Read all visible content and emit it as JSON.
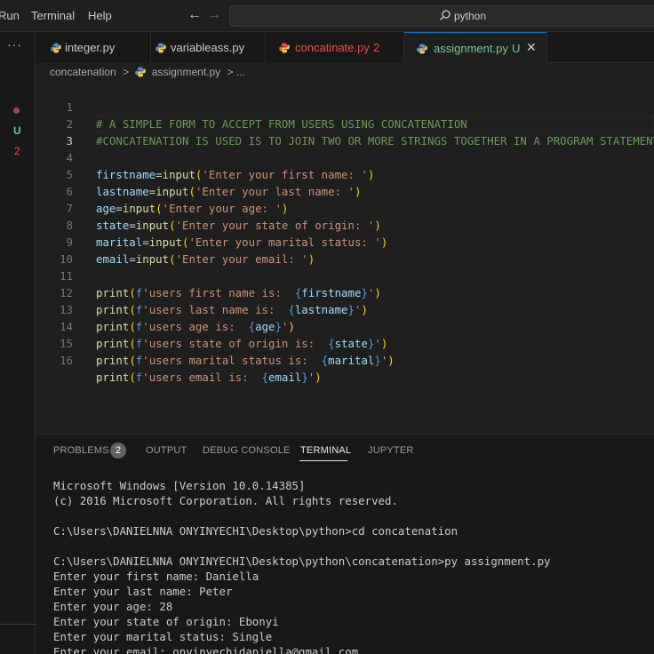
{
  "menu": {
    "run": "Run",
    "terminal": "Terminal",
    "help": "Help"
  },
  "nav": {
    "back": "←",
    "forward": "→"
  },
  "search": {
    "text": "python"
  },
  "sidebar": {
    "ellipsis": "···",
    "u_marker": "U",
    "problem_count": "2"
  },
  "tabs": [
    {
      "label": "integer.py",
      "color": "#cccccc",
      "icon_color": "#4f8cc9"
    },
    {
      "label": "variableass.py",
      "color": "#cccccc",
      "icon_color": "#4f8cc9"
    },
    {
      "label": "concatinate.py",
      "color": "#f14c4c",
      "icon_color": "#f14c4c",
      "badge": "2"
    },
    {
      "label": "assignment.py",
      "color": "#73c991",
      "icon_color": "#4f8cc9",
      "badge": "U",
      "close": "✕"
    }
  ],
  "breadcrumb": {
    "folder": "concatenation",
    "sep": ">",
    "file": "assignment.py",
    "rest": "> ..."
  },
  "editor": {
    "line_numbers": [
      "1",
      "2",
      "3",
      "4",
      "5",
      "6",
      "7",
      "8",
      "9",
      "10",
      "11",
      "12",
      "13",
      "14",
      "15",
      "16"
    ]
  },
  "panel": {
    "tabs": {
      "problems": "PROBLEMS",
      "output": "OUTPUT",
      "debug": "DEBUG CONSOLE",
      "terminal": "TERMINAL",
      "jupyter": "JUPYTER"
    },
    "problems_count": "2",
    "terminal_lines": [
      "Microsoft Windows [Version 10.0.14385]",
      "(c) 2016 Microsoft Corporation. All rights reserved.",
      "",
      "C:\\Users\\DANIELNNA ONYINYECHI\\Desktop\\python>cd concatenation",
      "",
      "C:\\Users\\DANIELNNA ONYINYECHI\\Desktop\\python\\concatenation>py assignment.py",
      "Enter your first name: Daniella",
      "Enter your last name: Peter",
      "Enter your age: 28",
      "Enter your state of origin: Ebonyi",
      "Enter your marital status: Single",
      "Enter your email: onyinyechidaniella@gmail.com"
    ]
  },
  "code": {
    "l1": "# A SIMPLE FORM TO ACCEPT FROM USERS USING CONCATENATION",
    "l2": "#CONCATENATION IS USED IS TO JOIN TWO OR MORE STRINGS TOGETHER IN A PROGRAM STATEMENT",
    "l4": {
      "v": "firstname",
      "s": "'Enter your first name: '"
    },
    "l5": {
      "v": "lastname",
      "s": "'Enter your last name: '"
    },
    "l6": {
      "v": "age",
      "s": "'Enter your age: '"
    },
    "l7": {
      "v": "state",
      "s": "'Enter your state of origin: '"
    },
    "l8": {
      "v": "marital",
      "s": "'Enter your marital status: '"
    },
    "l9": {
      "v": "email",
      "s": "'Enter your email: '"
    },
    "l11": {
      "s": "'users first name is:  ",
      "v": "firstname"
    },
    "l12": {
      "s": "'users last name is:  ",
      "v": "lastname"
    },
    "l13": {
      "s": "'users age is:  ",
      "v": "age"
    },
    "l14": {
      "s": "'users state of origin is:  ",
      "v": "state"
    },
    "l15": {
      "s": "'users marital status is:  ",
      "v": "marital"
    },
    "l16": {
      "s": "'users email is:  ",
      "v": "email"
    },
    "tokens": {
      "eq": "=",
      "input": "input",
      "print": "print",
      "lp": "(",
      "rp": ")",
      "f": "f",
      "lb": "{",
      "rb": "}",
      "q": "'"
    }
  },
  "colors": {
    "accent": "#0078d4",
    "untracked": "#73c991",
    "error": "#f14c4c"
  }
}
